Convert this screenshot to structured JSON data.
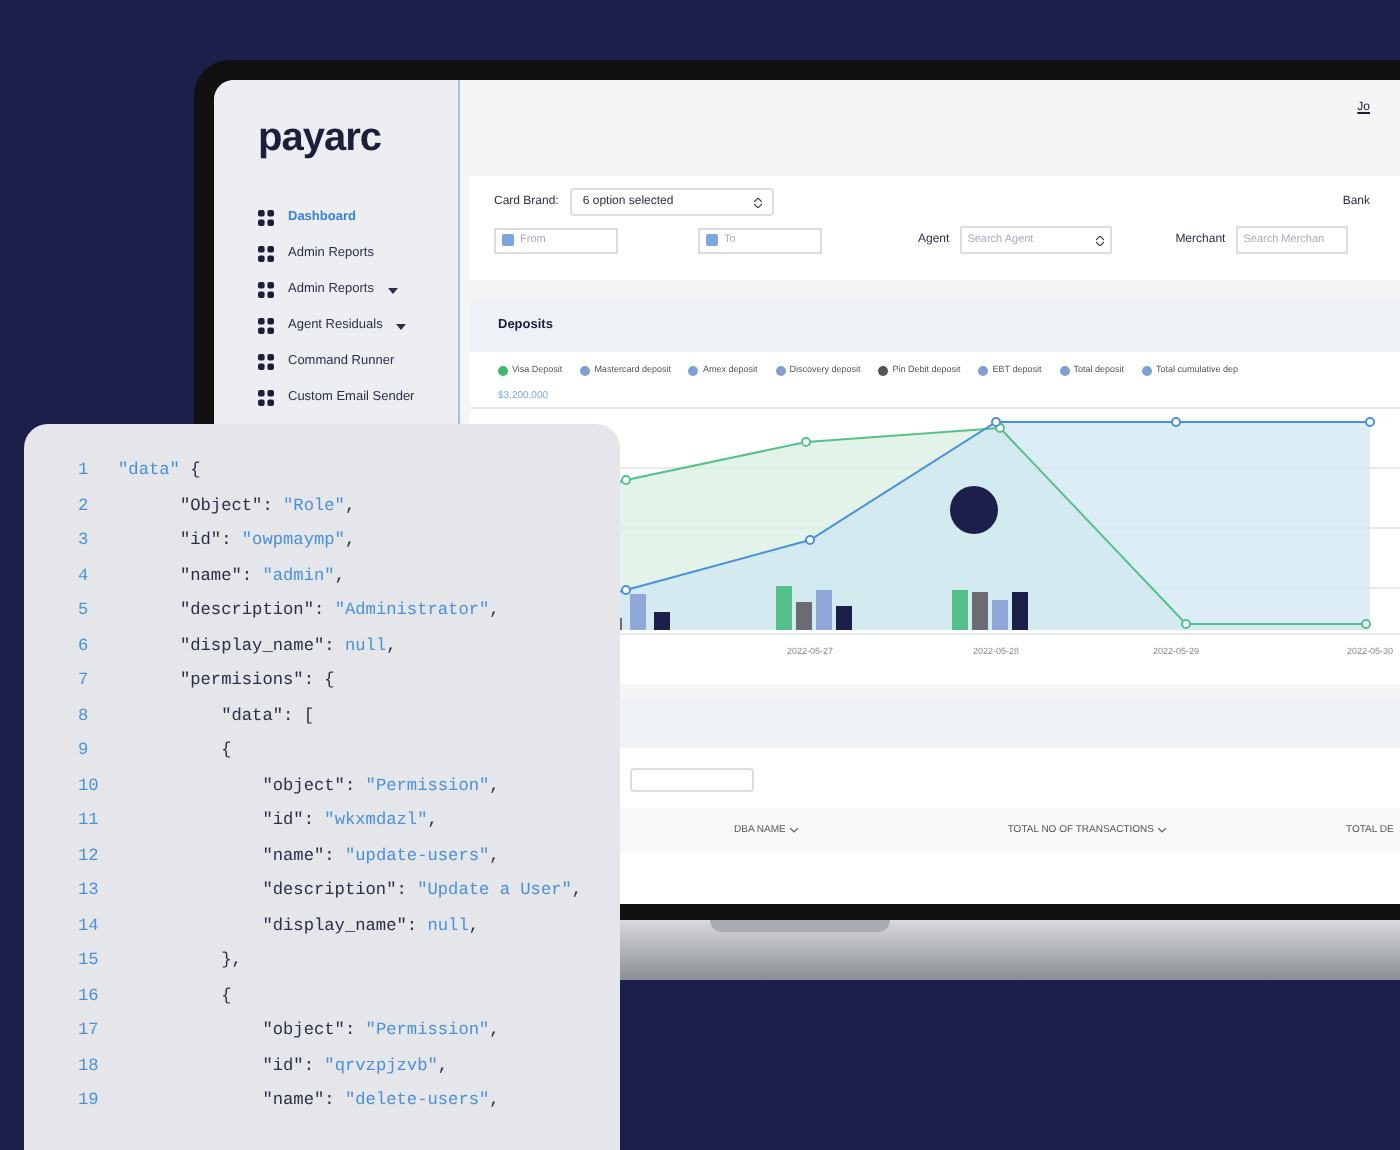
{
  "sidebar": {
    "logo": "payarc",
    "items": [
      {
        "label": "Dashboard",
        "selected": true,
        "has_caret": false
      },
      {
        "label": "Admin Reports",
        "selected": false,
        "has_caret": false
      },
      {
        "label": "Admin Reports",
        "selected": false,
        "has_caret": true
      },
      {
        "label": "Agent Residuals",
        "selected": false,
        "has_caret": true
      },
      {
        "label": "Command Runner",
        "selected": false,
        "has_caret": false
      },
      {
        "label": "Custom Email Sender",
        "selected": false,
        "has_caret": false
      }
    ]
  },
  "header": {
    "user_link": "Jo"
  },
  "filters": {
    "card_brand_label": "Card Brand:",
    "card_brand_value": "6 option selected",
    "bank_label": "Bank",
    "from_placeholder": "From",
    "to_placeholder": "To",
    "agent_label": "Agent",
    "agent_placeholder": "Search Agent",
    "merchant_label": "Merchant",
    "merchant_placeholder": "Search Merchan"
  },
  "deposits": {
    "title": "Deposits",
    "legend": [
      {
        "label": "Visa Deposit",
        "color": "#3fb870"
      },
      {
        "label": "Mastercard deposit",
        "color": "#7f9fd6"
      },
      {
        "label": "Amex deposit",
        "color": "#7f9fd6"
      },
      {
        "label": "Discovery deposit",
        "color": "#7f9fd6"
      },
      {
        "label": "Pin Debit deposit",
        "color": "#555555"
      },
      {
        "label": "EBT deposit",
        "color": "#7f9fd6"
      },
      {
        "label": "Total deposit",
        "color": "#7f9fd6"
      },
      {
        "label": "Total cumulative dep",
        "color": "#7f9fd6"
      }
    ],
    "y_label": "$3,200,000",
    "dates": [
      "2022-05-27",
      "2022-05-28",
      "2022-05-29",
      "2022-05-30"
    ]
  },
  "table": {
    "columns": [
      "DBA NAME",
      "TOTAL NO OF TRANSACTIONS",
      "TOTAL DE"
    ]
  },
  "code": {
    "lines": [
      {
        "number": "1",
        "parts": [
          {
            "kind": "value",
            "text": "\"data\""
          },
          {
            "kind": "key",
            "text": " {"
          }
        ]
      },
      {
        "number": "2",
        "parts": [
          {
            "kind": "key",
            "text": "      \"Object\": "
          },
          {
            "kind": "value",
            "text": "\"Role\""
          },
          {
            "kind": "key",
            "text": ","
          }
        ]
      },
      {
        "number": "3",
        "parts": [
          {
            "kind": "key",
            "text": "      \"id\": "
          },
          {
            "kind": "value",
            "text": "\"owpmaymp\""
          },
          {
            "kind": "key",
            "text": ","
          }
        ]
      },
      {
        "number": "4",
        "parts": [
          {
            "kind": "key",
            "text": "      \"name\": "
          },
          {
            "kind": "value",
            "text": "\"admin\""
          },
          {
            "kind": "key",
            "text": ","
          }
        ]
      },
      {
        "number": "5",
        "parts": [
          {
            "kind": "key",
            "text": "      \"description\": "
          },
          {
            "kind": "value",
            "text": "\"Administrator\""
          },
          {
            "kind": "key",
            "text": ","
          }
        ]
      },
      {
        "number": "6",
        "parts": [
          {
            "kind": "key",
            "text": "      \"display_name\": "
          },
          {
            "kind": "value",
            "text": "null"
          },
          {
            "kind": "key",
            "text": ","
          }
        ]
      },
      {
        "number": "7",
        "parts": [
          {
            "kind": "key",
            "text": "      \"permisions\": {"
          }
        ]
      },
      {
        "number": "8",
        "parts": [
          {
            "kind": "key",
            "text": "          \"data\": ["
          }
        ]
      },
      {
        "number": "9",
        "parts": [
          {
            "kind": "key",
            "text": "          {"
          }
        ]
      },
      {
        "number": "10",
        "parts": [
          {
            "kind": "key",
            "text": "              \"object\": "
          },
          {
            "kind": "value",
            "text": "\"Permission\""
          },
          {
            "kind": "key",
            "text": ","
          }
        ]
      },
      {
        "number": "11",
        "parts": [
          {
            "kind": "key",
            "text": "              \"id\": "
          },
          {
            "kind": "value",
            "text": "\"wkxmdazl\""
          },
          {
            "kind": "key",
            "text": ","
          }
        ]
      },
      {
        "number": "12",
        "parts": [
          {
            "kind": "key",
            "text": "              \"name\": "
          },
          {
            "kind": "value",
            "text": "\"update-users\""
          },
          {
            "kind": "key",
            "text": ","
          }
        ]
      },
      {
        "number": "13",
        "parts": [
          {
            "kind": "key",
            "text": "              \"description\": "
          },
          {
            "kind": "value",
            "text": "\"Update a User\""
          },
          {
            "kind": "key",
            "text": ","
          }
        ]
      },
      {
        "number": "14",
        "parts": [
          {
            "kind": "key",
            "text": "              \"display_name\": "
          },
          {
            "kind": "value",
            "text": "null"
          },
          {
            "kind": "key",
            "text": ","
          }
        ]
      },
      {
        "number": "15",
        "parts": [
          {
            "kind": "key",
            "text": "          },"
          }
        ]
      },
      {
        "number": "16",
        "parts": [
          {
            "kind": "key",
            "text": "          {"
          }
        ]
      },
      {
        "number": "17",
        "parts": [
          {
            "kind": "key",
            "text": "              \"object\": "
          },
          {
            "kind": "value",
            "text": "\"Permission\""
          },
          {
            "kind": "key",
            "text": ","
          }
        ]
      },
      {
        "number": "18",
        "parts": [
          {
            "kind": "key",
            "text": "              \"id\": "
          },
          {
            "kind": "value",
            "text": "\"qrvzpjzvb\""
          },
          {
            "kind": "key",
            "text": ","
          }
        ]
      },
      {
        "number": "19",
        "parts": [
          {
            "kind": "key",
            "text": "              \"name\": "
          },
          {
            "kind": "value",
            "text": "\"delete-users\""
          },
          {
            "kind": "key",
            "text": ","
          }
        ]
      }
    ]
  }
}
